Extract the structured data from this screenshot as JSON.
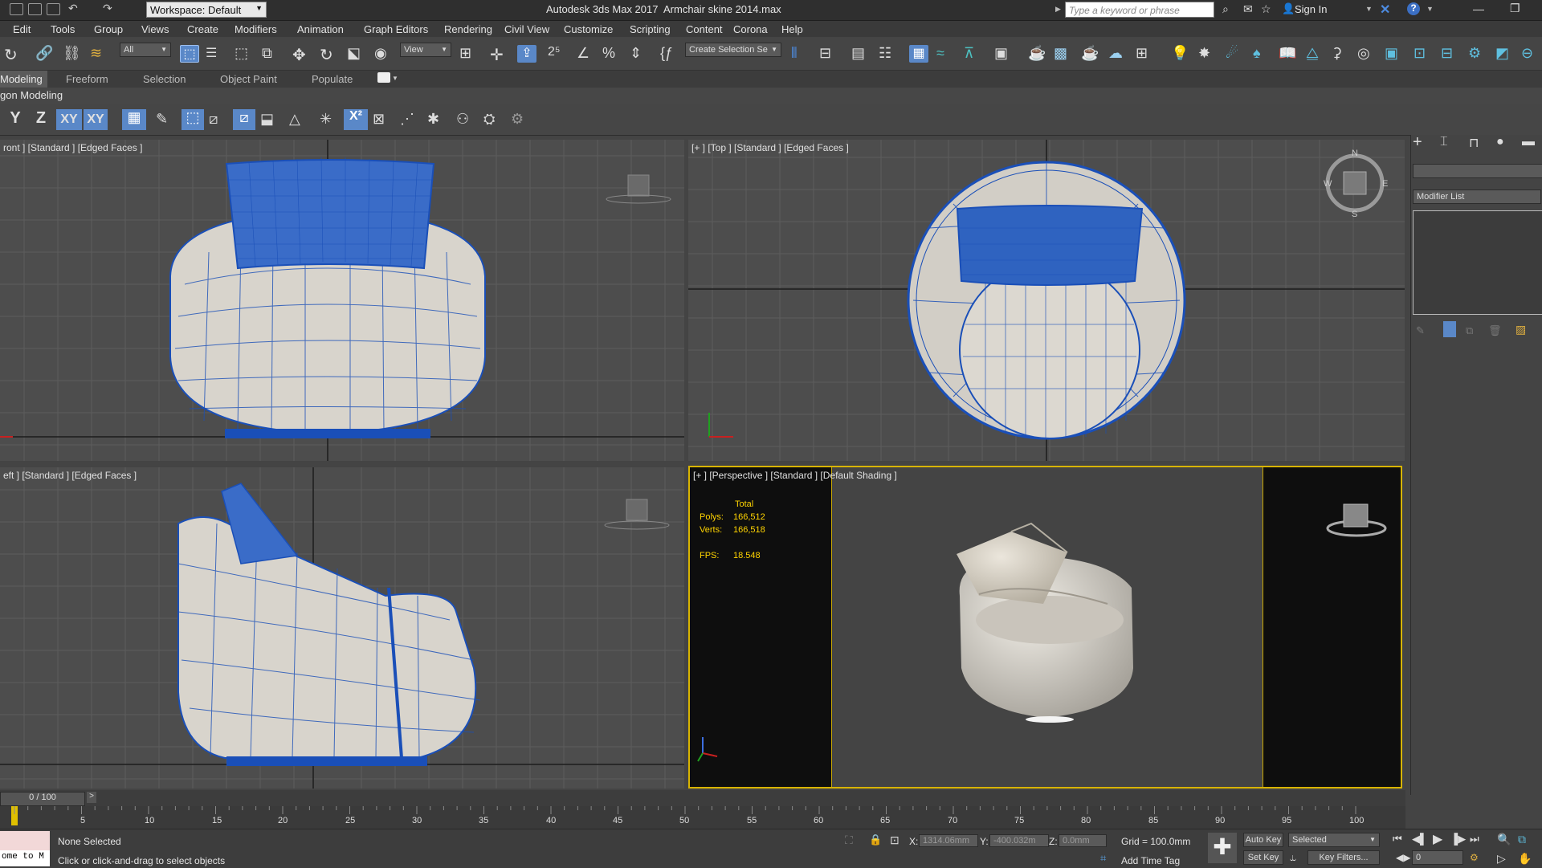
{
  "titlebar": {
    "workspace_label": "Workspace: Default",
    "app_title": "Autodesk 3ds Max 2017",
    "file_title": "Armchair skine  2014.max",
    "search_placeholder": "Type a keyword or phrase",
    "signin_label": "Sign In"
  },
  "menu": {
    "items": [
      "Edit",
      "Tools",
      "Group",
      "Views",
      "Create",
      "Modifiers",
      "Animation",
      "Graph Editors",
      "Rendering",
      "Civil View",
      "Customize",
      "Scripting",
      "Content",
      "Corona",
      "Help"
    ]
  },
  "toolbar": {
    "filter_value": "All",
    "ref_coord_value": "View",
    "selection_set_value": "Create Selection Se"
  },
  "ribbon": {
    "tabs": [
      "Modeling",
      "Freeform",
      "Selection",
      "Object Paint",
      "Populate"
    ],
    "panel_title": "gon Modeling"
  },
  "axisbar": {
    "buttons": [
      "Y",
      "Z",
      "XY",
      "XY"
    ]
  },
  "viewports": {
    "front_label": "ront ] [Standard ] [Edged Faces ]",
    "top_label": "[+ ] [Top ] [Standard ] [Edged Faces ]",
    "left_label": "eft ] [Standard ] [Edged Faces ]",
    "persp_label": "[+ ] [Perspective ] [Standard ] [Default Shading ]",
    "stats": {
      "header": "Total",
      "polys_label": "Polys:",
      "polys_value": "166,512",
      "verts_label": "Verts:",
      "verts_value": "166,518",
      "fps_label": "FPS:",
      "fps_value": "18.548"
    }
  },
  "command_panel": {
    "modifier_list_label": "Modifier List"
  },
  "timeline": {
    "frame_counter": "0 / 100",
    "ticks": [
      "5",
      "10",
      "15",
      "20",
      "25",
      "30",
      "35",
      "40",
      "45",
      "50",
      "55",
      "60",
      "65",
      "70",
      "75",
      "80",
      "85",
      "90",
      "95",
      "100"
    ]
  },
  "status": {
    "maxscript_text": "ome to M",
    "selection_text": "None Selected",
    "prompt_text": "Click or click-and-drag to select objects",
    "x_label": "X:",
    "x_value": "1314.06mm",
    "y_label": "Y:",
    "y_value": "-400.032m",
    "z_label": "Z:",
    "z_value": "0.0mm",
    "grid_text": "Grid = 100.0mm",
    "add_time_tag": "Add Time Tag",
    "auto_key": "Auto Key",
    "selected_value": "Selected",
    "set_key": "Set Key",
    "key_filters": "Key Filters...",
    "frame_value": "0"
  },
  "colors": {
    "wire": "#1a4fb8",
    "active_border": "#d8b400",
    "stats_text": "#ffd400",
    "grid_line": "#5d5d5d"
  }
}
